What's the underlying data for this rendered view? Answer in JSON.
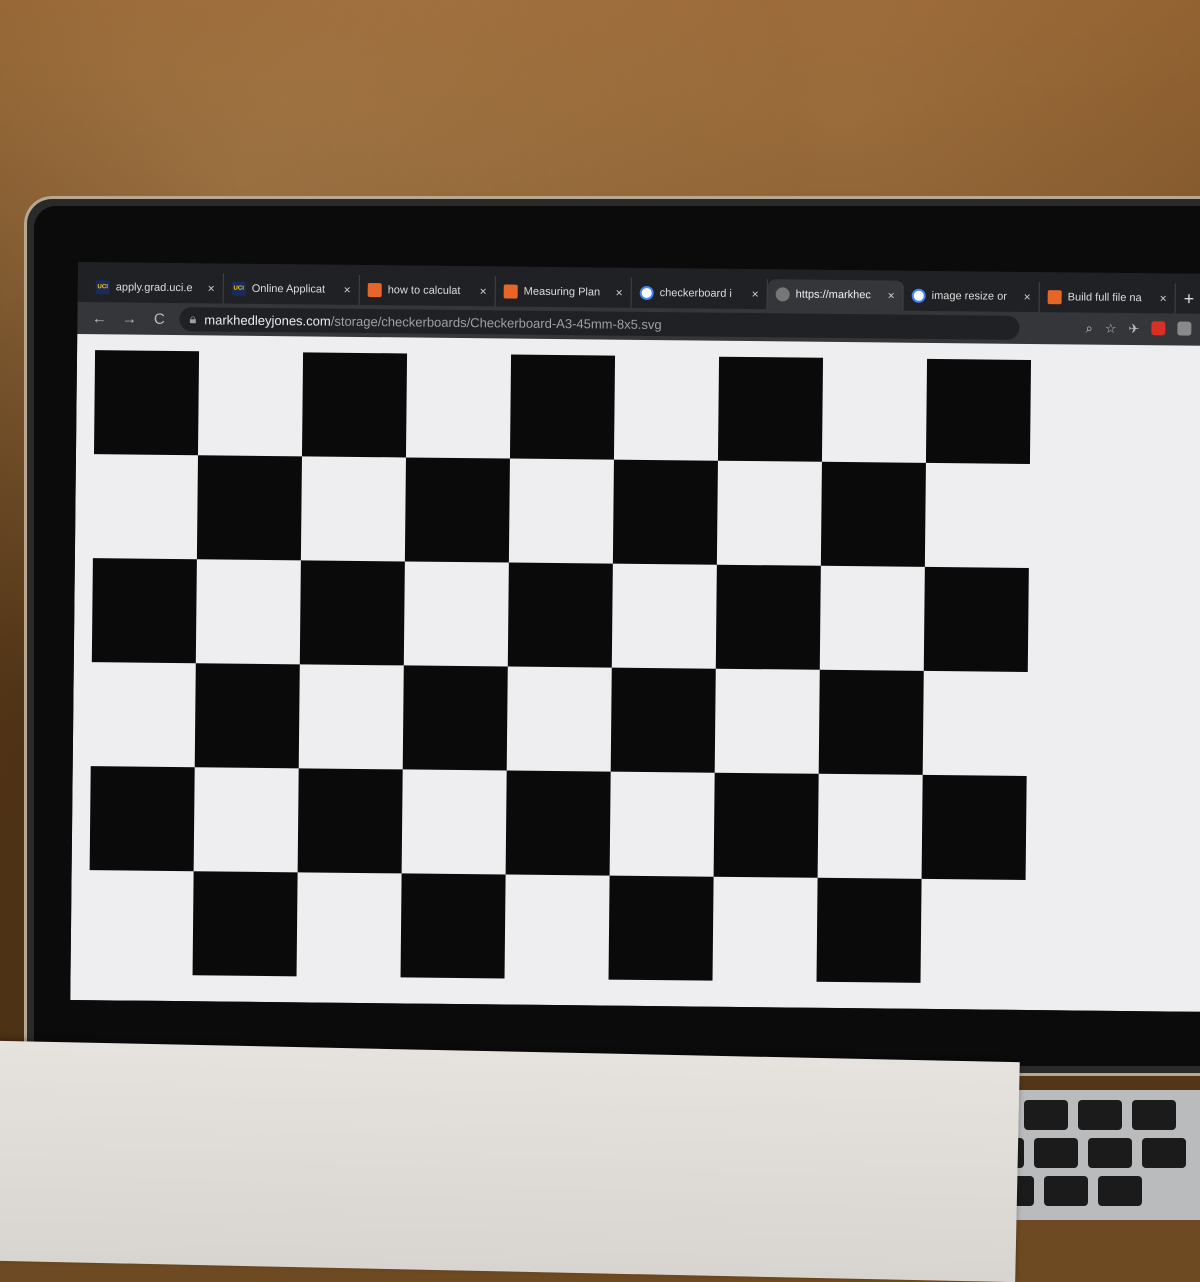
{
  "browser": {
    "tabs": [
      {
        "favicon": "UCI",
        "title": "apply.grad.uci.e",
        "active": false
      },
      {
        "favicon": "UCI",
        "title": "Online Applicat",
        "active": false
      },
      {
        "favicon": "matlab-icon",
        "title": "how to calculat",
        "active": false
      },
      {
        "favicon": "matlab-icon",
        "title": "Measuring Plan",
        "active": false
      },
      {
        "favicon": "google-icon",
        "title": "checkerboard i",
        "active": false
      },
      {
        "favicon": "globe-icon",
        "title": "https://markhec",
        "active": true
      },
      {
        "favicon": "google-icon",
        "title": "image resize or",
        "active": false
      },
      {
        "favicon": "matlab-icon",
        "title": "Build full file na",
        "active": false
      }
    ],
    "close_glyph": "×",
    "new_tab_glyph": "+",
    "back_glyph": "←",
    "forward_glyph": "→",
    "reload_glyph": "C",
    "url_host": "markhedleyjones.com",
    "url_path": "/storage/checkerboards/Checkerboard-A3-45mm-8x5.svg"
  },
  "page": {
    "checkerboard": {
      "columns": 9,
      "rows": 6,
      "top_left_dark": true
    }
  },
  "colors": {
    "square_dark": "#0a0a0a",
    "square_light": "#eeeef0"
  }
}
